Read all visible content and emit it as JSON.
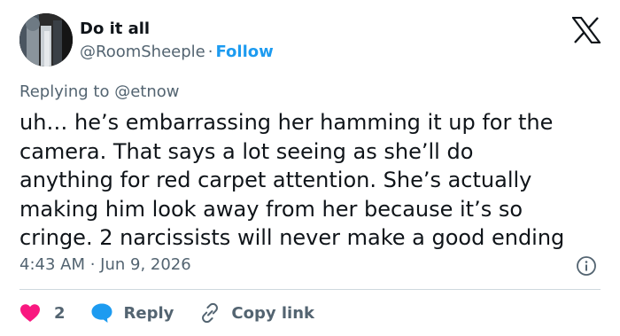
{
  "author": {
    "display_name": "Do it all",
    "handle": "@RoomSheeple",
    "separator": "·",
    "follow_label": "Follow"
  },
  "replying": {
    "prefix": "Replying to",
    "mention": "@etnow"
  },
  "tweet": {
    "lines": [
      "uh… he’s embarrassing her hamming it up for the",
      "camera. That says a lot seeing as she’ll do",
      "anything for red carpet attention. She’s actually",
      "making him look away from her because it’s so",
      "cringe. 2 narcissists will never make a good ending"
    ],
    "timestamp": "4:43 AM · Jun 9, 2026"
  },
  "actions": {
    "like_count": "2",
    "reply_label": "Reply",
    "copy_label": "Copy link"
  },
  "icons": {
    "logo": "x-logo-icon",
    "info": "info-icon",
    "heart": "heart-icon",
    "reply": "reply-bubble-icon",
    "link": "link-icon"
  },
  "colors": {
    "link_blue": "#1d9bf0",
    "like_red": "#f91880",
    "text": "#0f1419",
    "secondary": "#536471",
    "divider": "#cfd9de"
  }
}
